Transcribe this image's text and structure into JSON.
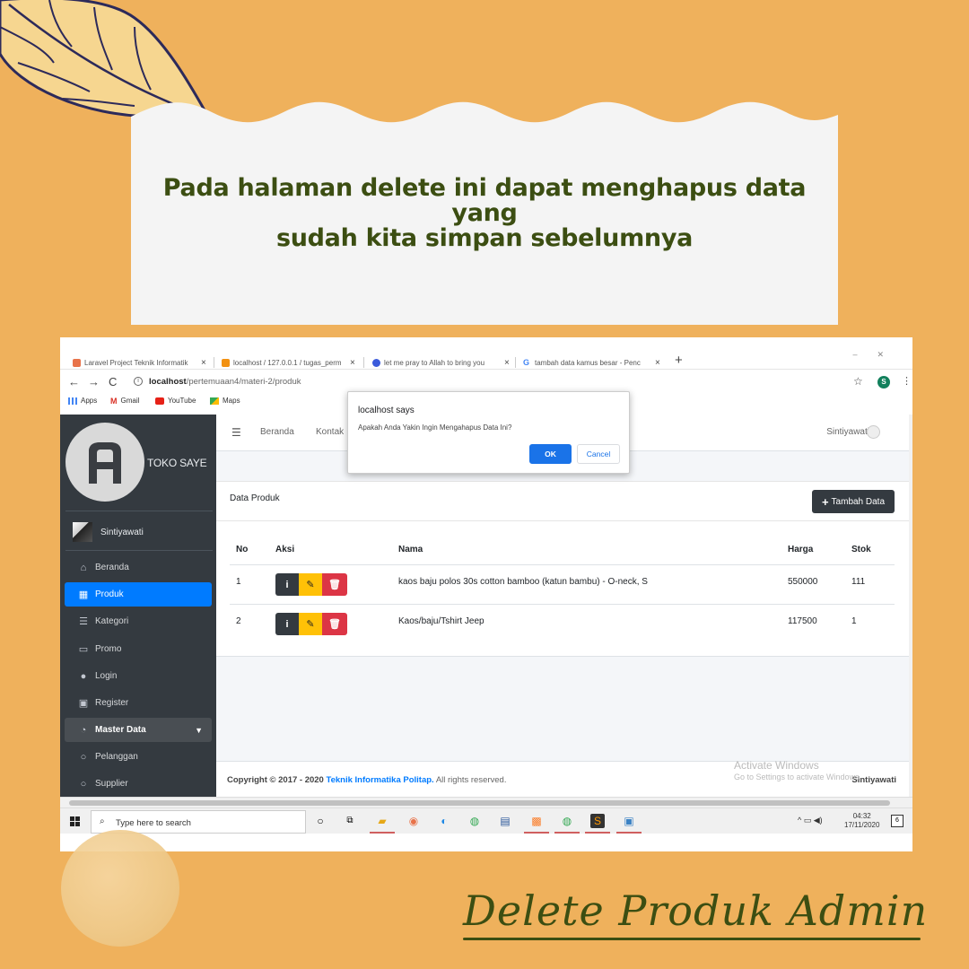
{
  "headline": {
    "line1": "Pada halaman delete ini dapat menghapus data yang",
    "line2": "sudah kita simpan sebelumnya"
  },
  "caption": "Delete Produk Admin",
  "browser": {
    "tabs": [
      {
        "label": "Laravel Project Teknik Informatik",
        "favicon_color": "#e8734a"
      },
      {
        "label": "localhost / 127.0.0.1 / tugas_perm",
        "favicon_color": "#f29111"
      },
      {
        "label": "let me pray to Allah to bring you",
        "favicon_color": "#3b5bdb"
      },
      {
        "label": "tambah data kamus besar - Penc",
        "favicon_color": "#4285f4"
      }
    ],
    "url_host": "localhost",
    "url_path": "/pertemuaan4/materi-2/produk",
    "profile_initial": "S",
    "bookmarks": [
      "Apps",
      "Gmail",
      "YouTube",
      "Maps"
    ]
  },
  "sidebar": {
    "brand": "TOKO SAYE",
    "user": "Sintiyawati",
    "items": [
      {
        "label": "Beranda",
        "icon": "home-icon",
        "glyph": "⌂"
      },
      {
        "label": "Produk",
        "icon": "grid-icon",
        "glyph": "▦",
        "active": true
      },
      {
        "label": "Kategori",
        "icon": "list-icon",
        "glyph": "☰"
      },
      {
        "label": "Promo",
        "icon": "window-icon",
        "glyph": "▭"
      },
      {
        "label": "Login",
        "icon": "user-icon",
        "glyph": "●"
      },
      {
        "label": "Register",
        "icon": "address-book-icon",
        "glyph": "▣"
      },
      {
        "label": "Master Data",
        "icon": "dashboard-icon",
        "glyph": "◔"
      },
      {
        "label": "Pelanggan",
        "icon": "circle-icon",
        "glyph": "○"
      },
      {
        "label": "Supplier",
        "icon": "circle-icon",
        "glyph": "○"
      }
    ]
  },
  "topnav": {
    "links": [
      "Beranda",
      "Kontak"
    ],
    "user": "Sintiyawati"
  },
  "card": {
    "title": "Data Produk",
    "add_button": "Tambah Data",
    "columns": [
      "No",
      "Aksi",
      "Nama",
      "Harga",
      "Stok"
    ],
    "rows": [
      {
        "no": "1",
        "nama": "kaos baju polos 30s cotton bamboo (katun bambu) - O-neck, S",
        "harga": "550000",
        "stok": "111"
      },
      {
        "no": "2",
        "nama": "Kaos/baju/Tshirt Jeep",
        "harga": "117500",
        "stok": "1"
      }
    ]
  },
  "footer": {
    "copyright": "Copyright © 2017 - 2020",
    "org": "Teknik Informatika Politap.",
    "rights": "All rights reserved.",
    "right": "Sintiyawati"
  },
  "watermark": {
    "line1": "Activate Windows",
    "line2": "Go to Settings to activate Windows."
  },
  "dialog": {
    "title": "localhost says",
    "message": "Apakah Anda Yakin Ingin Mengahapus Data Ini?",
    "ok": "OK",
    "cancel": "Cancel"
  },
  "taskbar": {
    "search_placeholder": "Type here to search",
    "time": "04:32",
    "date": "17/11/2020",
    "notification_count": "6"
  },
  "colors": {
    "background": "#efb15c",
    "headline": "#3c4e12",
    "sidebar": "#343a40",
    "active": "#007bff",
    "danger": "#dc3545",
    "warning": "#ffc107"
  }
}
